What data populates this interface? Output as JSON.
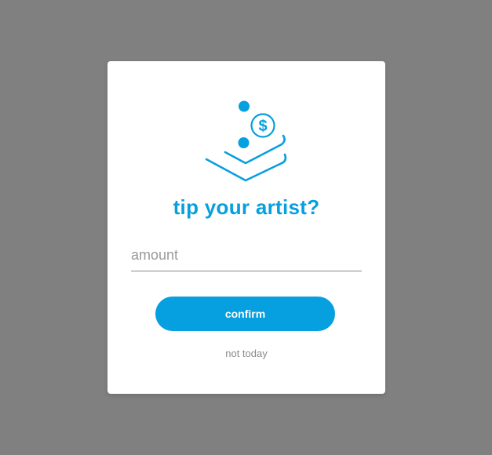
{
  "dialog": {
    "icon": "hand-with-coin-icon",
    "title": "tip your artist?",
    "amount_input": {
      "value": "",
      "placeholder": "amount"
    },
    "confirm_label": "confirm",
    "dismiss_label": "not today"
  },
  "colors": {
    "accent": "#069fdf",
    "overlay": "#808080",
    "dialog_background": "#ffffff",
    "secondary_text": "#8a8a8a"
  },
  "icon_text": {
    "coin_symbol": "$"
  }
}
